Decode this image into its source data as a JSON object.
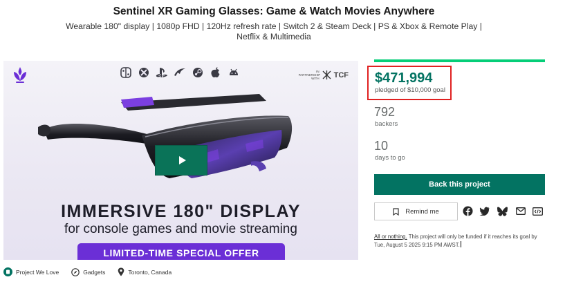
{
  "project": {
    "title": "Sentinel XR Gaming Glasses: Game & Watch Movies Anywhere",
    "subtitle": "Wearable 180\" display | 1080p FHD | 120Hz refresh rate | Switch 2 & Steam Deck | PS & Xbox & Remote Play | Netflix & Multimedia"
  },
  "media": {
    "platform_icons": [
      "switch-icon",
      "xbox-icon",
      "playstation-icon",
      "rog-icon",
      "steam-icon",
      "apple-icon",
      "android-icon"
    ],
    "partner_prefix": "IN PARTNERSHIP WITH",
    "partner_name": "TCF",
    "headline": "IMMERSIVE 180\" DISPLAY",
    "tagline": "for console games and movie streaming",
    "offer": "LIMITED-TIME SPECIAL OFFER",
    "play_icon": "play-icon"
  },
  "campaign": {
    "progress_fraction": 1.0,
    "pledged_amount": "$471,994",
    "pledged_goal": "pledged of $10,000 goal",
    "backers_count": "792",
    "backers_label": "backers",
    "days_count": "10",
    "days_label": "days to go",
    "back_button": "Back this project",
    "remind_button": "Remind me",
    "all_or_nothing_link": "All or nothing.",
    "all_or_nothing_text": " This project will only be funded if it reaches its goal by Tue, August 5 2025 9:15 PM AWST."
  },
  "share_icons": [
    "facebook-icon",
    "twitter-icon",
    "bluesky-icon",
    "email-icon",
    "embed-icon"
  ],
  "tags": [
    {
      "label": "Project We Love",
      "icon": "kickstarter-badge-icon"
    },
    {
      "label": "Gadgets",
      "icon": "compass-icon"
    },
    {
      "label": "Toronto, Canada",
      "icon": "location-pin-icon"
    }
  ],
  "colors": {
    "accent": "#037362",
    "progress": "#05ce78",
    "highlight_border": "#e02020",
    "offer_purple": "#6b2fd6"
  }
}
